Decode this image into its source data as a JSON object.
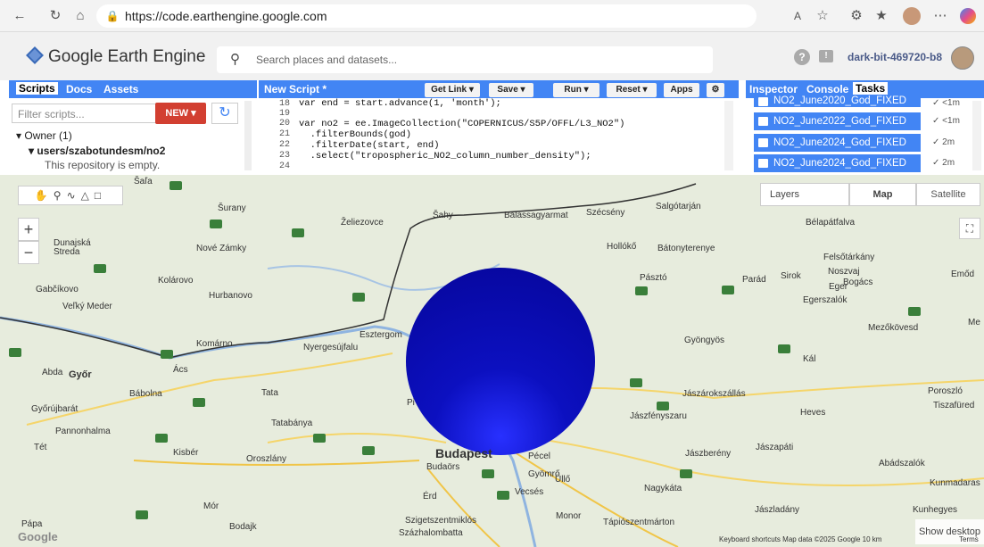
{
  "browser": {
    "url": "https://code.earthengine.google.com"
  },
  "header": {
    "title": "Google Earth Engine",
    "search_placeholder": "Search places and datasets...",
    "project": "dark-bit-469720-b8"
  },
  "left_panel": {
    "tabs": [
      "Scripts",
      "Docs",
      "Assets"
    ],
    "filter_placeholder": "Filter scripts...",
    "new_label": "NEW",
    "owner": "Owner (1)",
    "repo": "users/szabotundesm/no2",
    "empty": "This repository is empty."
  },
  "editor": {
    "title": "New Script *",
    "buttons": {
      "get_link": "Get Link",
      "save": "Save",
      "run": "Run",
      "reset": "Reset",
      "apps": "Apps"
    },
    "line_numbers": [
      "18",
      "19",
      "20",
      "21",
      "22",
      "23",
      "24"
    ],
    "lines": [
      "var end = start.advance(1, 'month');",
      "",
      "var no2 = ee.ImageCollection(\"COPERNICUS/S5P/OFFL/L3_NO2\")",
      "  .filterBounds(god)",
      "  .filterDate(start, end)",
      "  .select(\"tropospheric_NO2_column_number_density\");",
      ""
    ]
  },
  "right_panel": {
    "tabs": [
      "Inspector",
      "Console",
      "Tasks"
    ],
    "tasks": [
      {
        "name": "NO2_June2020_God_FIXED",
        "time": "<1m"
      },
      {
        "name": "NO2_June2022_God_FIXED",
        "time": "<1m"
      },
      {
        "name": "NO2_June2024_God_FIXED",
        "time": "2m"
      },
      {
        "name": "NO2_June2024_God_FIXED",
        "time": "2m"
      }
    ]
  },
  "map": {
    "layers": "Layers",
    "map_type": "Map",
    "satellite": "Satellite",
    "show_desktop": "Show desktop",
    "attribution": "Keyboard shortcuts   Map data ©2025 Google   10 km",
    "terms": "Terms",
    "google": "Google",
    "places": [
      {
        "name": "Šaľa"
      },
      {
        "name": "Šurany"
      },
      {
        "name": "Želiezovce"
      },
      {
        "name": "Šahy"
      },
      {
        "name": "Balassagyarmat"
      },
      {
        "name": "Szécsény"
      },
      {
        "name": "Salgótarján"
      },
      {
        "name": "Bélapátfalva"
      },
      {
        "name": "Dunajská Streda"
      },
      {
        "name": "Nové Zámky"
      },
      {
        "name": "Hollókő"
      },
      {
        "name": "Bátonyterenye"
      },
      {
        "name": "Felsőtárkány"
      },
      {
        "name": "Gabčíkovo"
      },
      {
        "name": "Kolárovo"
      },
      {
        "name": "Pásztó"
      },
      {
        "name": "Parád"
      },
      {
        "name": "Sirok"
      },
      {
        "name": "Noszvaj"
      },
      {
        "name": "Bogács"
      },
      {
        "name": "Eger"
      },
      {
        "name": "Emőd"
      },
      {
        "name": "Egerszalók"
      },
      {
        "name": "Veľký Meder"
      },
      {
        "name": "Hurbanovo"
      },
      {
        "name": "Mezőkövesd"
      },
      {
        "name": "Esztergom"
      },
      {
        "name": "Gyöngyös"
      },
      {
        "name": "Komárno"
      },
      {
        "name": "Nyergesújfalu"
      },
      {
        "name": "Kál"
      },
      {
        "name": "Abda"
      },
      {
        "name": "Győr"
      },
      {
        "name": "Ács"
      },
      {
        "name": "Bábolna"
      },
      {
        "name": "Tata"
      },
      {
        "name": "Jászárokszállás"
      },
      {
        "name": "Poroszló"
      },
      {
        "name": "Tiszafüred"
      },
      {
        "name": "Győrújbarát"
      },
      {
        "name": "Heves"
      },
      {
        "name": "Jászfényszaru"
      },
      {
        "name": "Pannonhalma"
      },
      {
        "name": "Tatabánya"
      },
      {
        "name": "Tét"
      },
      {
        "name": "Kisbér"
      },
      {
        "name": "Oroszlány"
      },
      {
        "name": "Budapest"
      },
      {
        "name": "Pécel"
      },
      {
        "name": "Jászberény"
      },
      {
        "name": "Jászapáti"
      },
      {
        "name": "Abádszalók"
      },
      {
        "name": "Budaörs"
      },
      {
        "name": "Gyömrő"
      },
      {
        "name": "Érd"
      },
      {
        "name": "Vecsés"
      },
      {
        "name": "Nagykáta"
      },
      {
        "name": "Kunmadaras"
      },
      {
        "name": "Mór"
      },
      {
        "name": "Jászladány"
      },
      {
        "name": "Kunhegyes"
      },
      {
        "name": "Pápa"
      },
      {
        "name": "Bodajk"
      },
      {
        "name": "Szigetszentmiklós"
      },
      {
        "name": "Monor"
      },
      {
        "name": "Tápiószentmárton"
      },
      {
        "name": "Százhalombatta"
      },
      {
        "name": "Üllő"
      },
      {
        "name": "Pi"
      },
      {
        "name": "Me"
      }
    ]
  },
  "colors": {
    "accent": "#4285f4",
    "new_button": "#d23f31",
    "blob": "#1010c8"
  }
}
